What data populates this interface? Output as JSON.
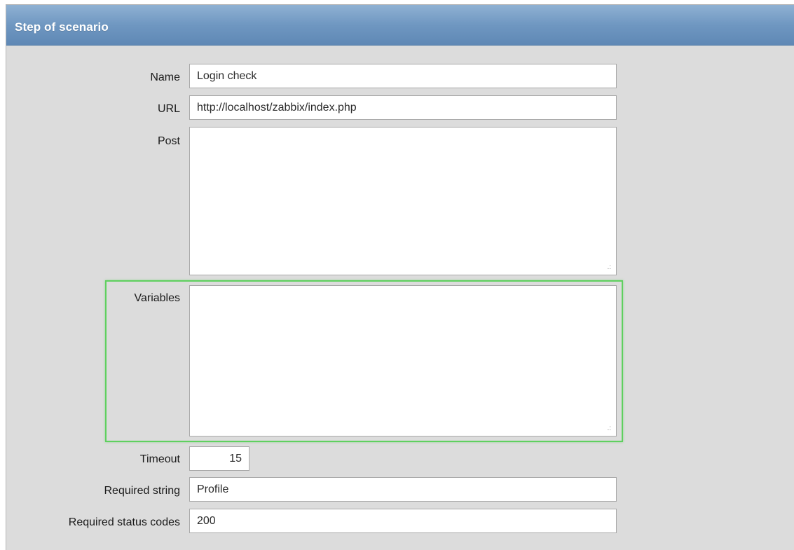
{
  "window": {
    "title": "Step of scenario"
  },
  "form": {
    "name": {
      "label": "Name",
      "value": "Login check"
    },
    "url": {
      "label": "URL",
      "value": "http://localhost/zabbix/index.php"
    },
    "post": {
      "label": "Post",
      "value": ""
    },
    "variables": {
      "label": "Variables",
      "value": "",
      "highlighted": true
    },
    "timeout": {
      "label": "Timeout",
      "value": "15"
    },
    "required_string": {
      "label": "Required string",
      "value": "Profile"
    },
    "required_status_codes": {
      "label": "Required status codes",
      "value": "200"
    }
  },
  "colors": {
    "titlebar": "#6f97c1",
    "highlight": "#5fd05f",
    "background": "#dcdcdc"
  }
}
